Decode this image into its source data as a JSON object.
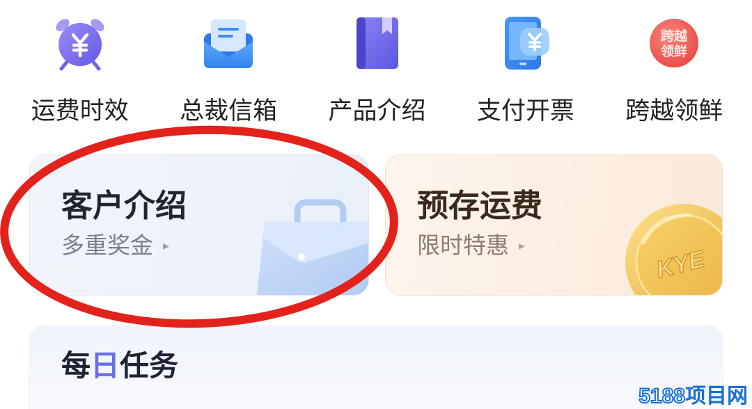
{
  "shortcuts": [
    {
      "label": "运费时效",
      "icon": "alarm-clock-yuan-icon"
    },
    {
      "label": "总裁信箱",
      "icon": "mail-envelope-icon"
    },
    {
      "label": "产品介绍",
      "icon": "book-icon"
    },
    {
      "label": "支付开票",
      "icon": "phone-yuan-payment-icon"
    },
    {
      "label": "跨越领鲜",
      "icon": "kuayue-lingxian-logo-icon",
      "logo_text": [
        "跨越",
        "领鲜"
      ]
    }
  ],
  "promo_cards": [
    {
      "title": "客户介绍",
      "subtitle": "多重奖金",
      "arrow": "▸",
      "illustration": "briefcase-icon"
    },
    {
      "title": "预存运费",
      "subtitle": "限时特惠",
      "arrow": "▸",
      "illustration": "gold-coin-icon",
      "coin_text": "KYE"
    }
  ],
  "daily_tasks": {
    "title_parts": [
      "每",
      "日",
      "任务"
    ]
  },
  "annotation": {
    "color": "#e3221c"
  },
  "watermark": {
    "digits": "5188",
    "text": "项目网"
  },
  "colors": {
    "label_text": "#222222",
    "title_text": "#1f2233",
    "daily_title_highlight": "#6b6ee8",
    "subtitle_text": "#7b7f88",
    "prepaid_title": "#3a2a1e",
    "coin_gold": "#f0bd4a",
    "icon_purple": "#7366ee",
    "icon_blue": "#3e8af2",
    "logo_red": "#ee5a52",
    "watermark_blue": "#1a6fd8"
  }
}
